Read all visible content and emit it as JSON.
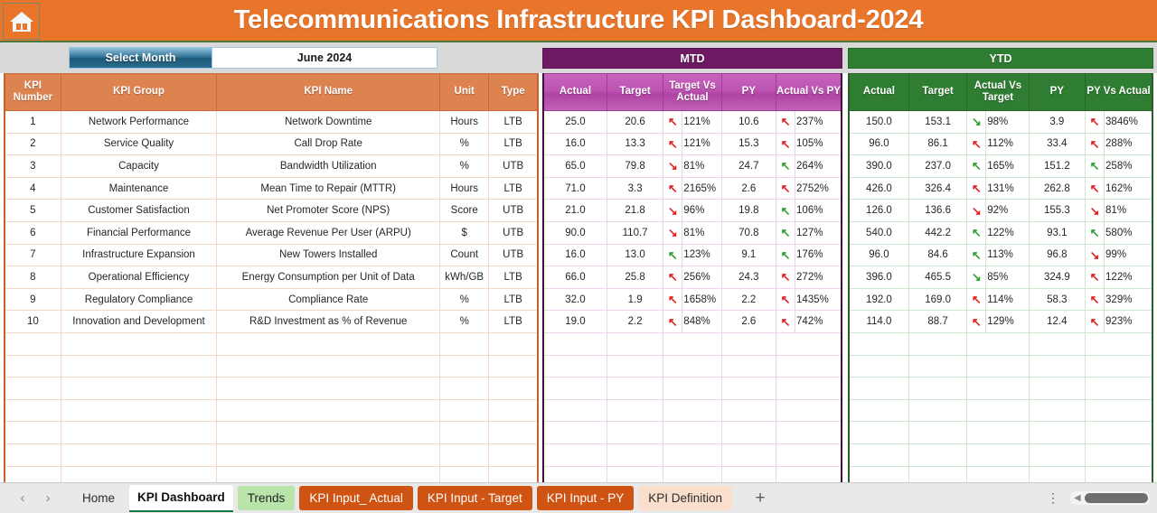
{
  "header": {
    "home_icon": "home-icon",
    "title": "Telecommunications Infrastructure KPI Dashboard-2024"
  },
  "controls": {
    "select_month_label": "Select Month",
    "selected_month": "June 2024"
  },
  "groups": {
    "mtd": "MTD",
    "ytd": "YTD"
  },
  "left_columns": [
    "KPI Number",
    "KPI Group",
    "KPI Name",
    "Unit",
    "Type"
  ],
  "mtd_columns": [
    "Actual",
    "Target",
    "Target Vs Actual",
    "PY",
    "Actual Vs PY"
  ],
  "ytd_columns": [
    "Actual",
    "Target",
    "Actual Vs Target",
    "PY",
    "PY Vs Actual"
  ],
  "rows": [
    {
      "num": "1",
      "group": "Network Performance",
      "name": "Network Downtime",
      "unit": "Hours",
      "type": "LTB",
      "mtd": {
        "actual": "25.0",
        "target": "20.6",
        "tva": "121%",
        "tva_arrow": "up-red",
        "py": "10.6",
        "avp": "237%",
        "avp_arrow": "up-red"
      },
      "ytd": {
        "actual": "150.0",
        "target": "153.1",
        "avt": "98%",
        "avt_arrow": "down-green",
        "py": "3.9",
        "pva": "3846%",
        "pva_arrow": "up-red"
      }
    },
    {
      "num": "2",
      "group": "Service Quality",
      "name": "Call Drop Rate",
      "unit": "%",
      "type": "LTB",
      "mtd": {
        "actual": "16.0",
        "target": "13.3",
        "tva": "121%",
        "tva_arrow": "up-red",
        "py": "15.3",
        "avp": "105%",
        "avp_arrow": "up-red"
      },
      "ytd": {
        "actual": "96.0",
        "target": "86.1",
        "avt": "112%",
        "avt_arrow": "up-red",
        "py": "33.4",
        "pva": "288%",
        "pva_arrow": "up-red"
      }
    },
    {
      "num": "3",
      "group": "Capacity",
      "name": "Bandwidth Utilization",
      "unit": "%",
      "type": "UTB",
      "mtd": {
        "actual": "65.0",
        "target": "79.8",
        "tva": "81%",
        "tva_arrow": "down-red",
        "py": "24.7",
        "avp": "264%",
        "avp_arrow": "up-green"
      },
      "ytd": {
        "actual": "390.0",
        "target": "237.0",
        "avt": "165%",
        "avt_arrow": "up-green",
        "py": "151.2",
        "pva": "258%",
        "pva_arrow": "up-green"
      }
    },
    {
      "num": "4",
      "group": "Maintenance",
      "name": "Mean Time to Repair (MTTR)",
      "unit": "Hours",
      "type": "LTB",
      "mtd": {
        "actual": "71.0",
        "target": "3.3",
        "tva": "2165%",
        "tva_arrow": "up-red",
        "py": "2.6",
        "avp": "2752%",
        "avp_arrow": "up-red"
      },
      "ytd": {
        "actual": "426.0",
        "target": "326.4",
        "avt": "131%",
        "avt_arrow": "up-red",
        "py": "262.8",
        "pva": "162%",
        "pva_arrow": "up-red"
      }
    },
    {
      "num": "5",
      "group": "Customer Satisfaction",
      "name": "Net Promoter Score (NPS)",
      "unit": "Score",
      "type": "UTB",
      "mtd": {
        "actual": "21.0",
        "target": "21.8",
        "tva": "96%",
        "tva_arrow": "down-red",
        "py": "19.8",
        "avp": "106%",
        "avp_arrow": "up-green"
      },
      "ytd": {
        "actual": "126.0",
        "target": "136.6",
        "avt": "92%",
        "avt_arrow": "down-red",
        "py": "155.3",
        "pva": "81%",
        "pva_arrow": "down-red"
      }
    },
    {
      "num": "6",
      "group": "Financial Performance",
      "name": "Average Revenue Per User (ARPU)",
      "unit": "$",
      "type": "UTB",
      "mtd": {
        "actual": "90.0",
        "target": "110.7",
        "tva": "81%",
        "tva_arrow": "down-red",
        "py": "70.8",
        "avp": "127%",
        "avp_arrow": "up-green"
      },
      "ytd": {
        "actual": "540.0",
        "target": "442.2",
        "avt": "122%",
        "avt_arrow": "up-green",
        "py": "93.1",
        "pva": "580%",
        "pva_arrow": "up-green"
      }
    },
    {
      "num": "7",
      "group": "Infrastructure Expansion",
      "name": "New Towers Installed",
      "unit": "Count",
      "type": "UTB",
      "mtd": {
        "actual": "16.0",
        "target": "13.0",
        "tva": "123%",
        "tva_arrow": "up-green",
        "py": "9.1",
        "avp": "176%",
        "avp_arrow": "up-green"
      },
      "ytd": {
        "actual": "96.0",
        "target": "84.6",
        "avt": "113%",
        "avt_arrow": "up-green",
        "py": "96.8",
        "pva": "99%",
        "pva_arrow": "down-red"
      }
    },
    {
      "num": "8",
      "group": "Operational Efficiency",
      "name": "Energy Consumption per Unit of Data",
      "unit": "kWh/GB",
      "type": "LTB",
      "mtd": {
        "actual": "66.0",
        "target": "25.8",
        "tva": "256%",
        "tva_arrow": "up-red",
        "py": "24.3",
        "avp": "272%",
        "avp_arrow": "up-red"
      },
      "ytd": {
        "actual": "396.0",
        "target": "465.5",
        "avt": "85%",
        "avt_arrow": "down-green",
        "py": "324.9",
        "pva": "122%",
        "pva_arrow": "up-red"
      }
    },
    {
      "num": "9",
      "group": "Regulatory Compliance",
      "name": "Compliance Rate",
      "unit": "%",
      "type": "LTB",
      "mtd": {
        "actual": "32.0",
        "target": "1.9",
        "tva": "1658%",
        "tva_arrow": "up-red",
        "py": "2.2",
        "avp": "1435%",
        "avp_arrow": "up-red"
      },
      "ytd": {
        "actual": "192.0",
        "target": "169.0",
        "avt": "114%",
        "avt_arrow": "up-red",
        "py": "58.3",
        "pva": "329%",
        "pva_arrow": "up-red"
      }
    },
    {
      "num": "10",
      "group": "Innovation and Development",
      "name": "R&D Investment as % of Revenue",
      "unit": "%",
      "type": "LTB",
      "mtd": {
        "actual": "19.0",
        "target": "2.2",
        "tva": "848%",
        "tva_arrow": "up-red",
        "py": "2.6",
        "avp": "742%",
        "avp_arrow": "up-red"
      },
      "ytd": {
        "actual": "114.0",
        "target": "88.7",
        "avt": "129%",
        "avt_arrow": "up-red",
        "py": "12.4",
        "pva": "923%",
        "pva_arrow": "up-red"
      }
    }
  ],
  "empty_row_count": 7,
  "tabs": [
    {
      "label": "Home",
      "style": "plain"
    },
    {
      "label": "KPI Dashboard",
      "style": "active"
    },
    {
      "label": "Trends",
      "style": "green"
    },
    {
      "label": "KPI Input_ Actual",
      "style": "orange"
    },
    {
      "label": "KPI Input - Target",
      "style": "orange"
    },
    {
      "label": "KPI Input - PY",
      "style": "orange"
    },
    {
      "label": "KPI Definition",
      "style": "peach"
    }
  ],
  "tabbar": {
    "prev_icon": "chevron-left-icon",
    "next_icon": "chevron-right-icon",
    "add_sheet_label": "+",
    "kebab_icon": "more-options-icon",
    "scroll_left_icon": "scroll-left-icon"
  },
  "colors": {
    "title_bg": "#e8752a",
    "left_header": "#dd8350",
    "mtd_header": "#6d1a63",
    "mtd_subheader": "#bb52b0",
    "ytd_header": "#2f7d32",
    "arrow_red": "#e02020",
    "arrow_green": "#2f9e2f"
  }
}
